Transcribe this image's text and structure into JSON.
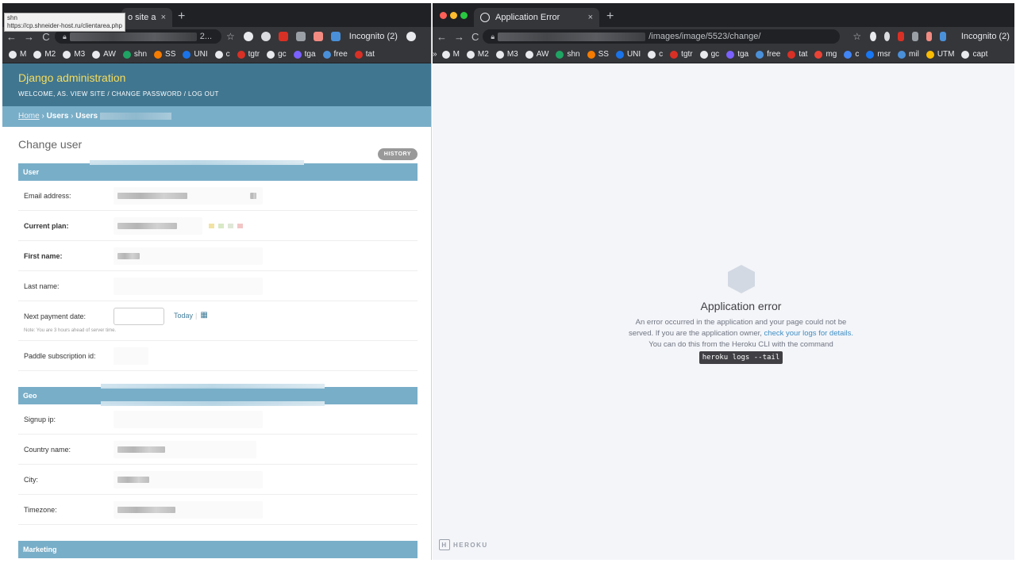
{
  "left_window": {
    "tab": {
      "title": "o site adm",
      "close": "×"
    },
    "new_tab": "+",
    "tooltip": {
      "title": "shn",
      "url": "https://cp.shneider-host.ru/clientarea.php"
    },
    "toolbar": {
      "back": "←",
      "forward": "→",
      "reload": "C",
      "url_suffix": "2...",
      "star": "☆",
      "incognito": "Incognito (2)"
    },
    "bookmarks": [
      "M",
      "M2",
      "M3",
      "AW",
      "shn",
      "SS",
      "UNI",
      "c",
      "tgtr",
      "gc",
      "tga",
      "free",
      "tat"
    ],
    "django": {
      "brand": "Django administration",
      "user_tools": "WELCOME, AS. VIEW SITE / CHANGE PASSWORD / LOG OUT",
      "breadcrumbs": {
        "home": "Home",
        "sep": " › ",
        "section": "Users",
        "model": "Users"
      },
      "page_title": "Change user",
      "history_button": "HISTORY",
      "fieldsets": [
        {
          "name": "User",
          "fields": [
            {
              "label": "Email address:",
              "required": false
            },
            {
              "label": "Current plan:",
              "required": true
            },
            {
              "label": "First name:",
              "required": true
            },
            {
              "label": "Last name:",
              "required": false
            },
            {
              "label": "Next payment date:",
              "required": false,
              "today": "Today",
              "help": "Note: You are 3 hours ahead of server time."
            },
            {
              "label": "Paddle subscription id:",
              "required": false
            }
          ]
        },
        {
          "name": "Geo",
          "fields": [
            {
              "label": "Signup ip:",
              "required": false
            },
            {
              "label": "Country name:",
              "required": false
            },
            {
              "label": "City:",
              "required": false
            },
            {
              "label": "Timezone:",
              "required": false
            }
          ]
        },
        {
          "name": "Marketing",
          "fields": []
        }
      ]
    }
  },
  "right_window": {
    "tab": {
      "title": "Application Error",
      "close": "×"
    },
    "new_tab": "+",
    "toolbar": {
      "back": "←",
      "forward": "→",
      "reload": "C",
      "url_path": "/images/image/5523/change/",
      "star": "☆",
      "incognito": "Incognito (2)"
    },
    "bookmarks_overflow": "»",
    "bookmarks": [
      "M",
      "M2",
      "M3",
      "AW",
      "shn",
      "SS",
      "UNI",
      "c",
      "tgtr",
      "gc",
      "tga",
      "free",
      "tat",
      "mg",
      "c",
      "msr",
      "mil",
      "UTM",
      "capt"
    ],
    "error": {
      "title": "Application error",
      "line1": "An error occurred in the application and your page could not be served. If you are the application owner, ",
      "link": "check your logs for details.",
      "line2": " You can do this from the Heroku CLI with the command",
      "command": "heroku logs --tail",
      "logo": "HEROKU",
      "logo_mark": "H"
    }
  },
  "colors": {
    "django_header": "#417690",
    "django_accent": "#79aec8",
    "django_brand": "#f5dd5d",
    "heroku_bg": "#f4f5f9",
    "heroku_link": "#3e8ec4",
    "chrome_dark": "#35363a"
  }
}
